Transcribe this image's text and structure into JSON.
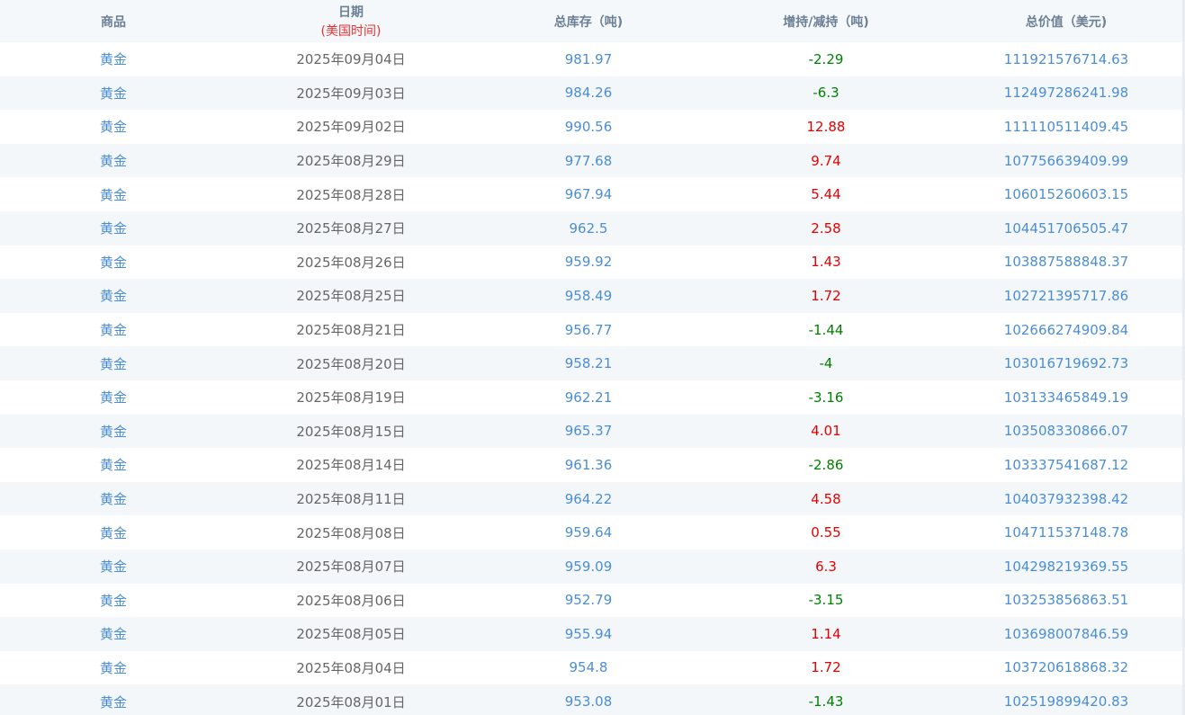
{
  "colors": {
    "header_bg": "#f4f8fb",
    "header_text": "#6b7f95",
    "subheader_text": "#e53333",
    "link_blue": "#4b8ed2",
    "date_text": "#666666",
    "increase": "#e60000",
    "decrease": "#008000",
    "stripe": "#f4f7fa"
  },
  "header": {
    "product": "商品",
    "date": "日期",
    "date_note": "(美国时间)",
    "total": "总库存（吨)",
    "change": "增持/减持（吨)",
    "value": "总价值（美元)"
  },
  "rows": [
    {
      "product": "黄金",
      "date": "2025年09月04日",
      "total": "981.97",
      "change": "-2.29",
      "direction": "down",
      "value": "111921576714.63"
    },
    {
      "product": "黄金",
      "date": "2025年09月03日",
      "total": "984.26",
      "change": "-6.3",
      "direction": "down",
      "value": "112497286241.98"
    },
    {
      "product": "黄金",
      "date": "2025年09月02日",
      "total": "990.56",
      "change": "12.88",
      "direction": "up",
      "value": "111110511409.45"
    },
    {
      "product": "黄金",
      "date": "2025年08月29日",
      "total": "977.68",
      "change": "9.74",
      "direction": "up",
      "value": "107756639409.99"
    },
    {
      "product": "黄金",
      "date": "2025年08月28日",
      "total": "967.94",
      "change": "5.44",
      "direction": "up",
      "value": "106015260603.15"
    },
    {
      "product": "黄金",
      "date": "2025年08月27日",
      "total": "962.5",
      "change": "2.58",
      "direction": "up",
      "value": "104451706505.47"
    },
    {
      "product": "黄金",
      "date": "2025年08月26日",
      "total": "959.92",
      "change": "1.43",
      "direction": "up",
      "value": "103887588848.37"
    },
    {
      "product": "黄金",
      "date": "2025年08月25日",
      "total": "958.49",
      "change": "1.72",
      "direction": "up",
      "value": "102721395717.86"
    },
    {
      "product": "黄金",
      "date": "2025年08月21日",
      "total": "956.77",
      "change": "-1.44",
      "direction": "down",
      "value": "102666274909.84"
    },
    {
      "product": "黄金",
      "date": "2025年08月20日",
      "total": "958.21",
      "change": "-4",
      "direction": "down",
      "value": "103016719692.73"
    },
    {
      "product": "黄金",
      "date": "2025年08月19日",
      "total": "962.21",
      "change": "-3.16",
      "direction": "down",
      "value": "103133465849.19"
    },
    {
      "product": "黄金",
      "date": "2025年08月15日",
      "total": "965.37",
      "change": "4.01",
      "direction": "up",
      "value": "103508330866.07"
    },
    {
      "product": "黄金",
      "date": "2025年08月14日",
      "total": "961.36",
      "change": "-2.86",
      "direction": "down",
      "value": "103337541687.12"
    },
    {
      "product": "黄金",
      "date": "2025年08月11日",
      "total": "964.22",
      "change": "4.58",
      "direction": "up",
      "value": "104037932398.42"
    },
    {
      "product": "黄金",
      "date": "2025年08月08日",
      "total": "959.64",
      "change": "0.55",
      "direction": "up",
      "value": "104711537148.78"
    },
    {
      "product": "黄金",
      "date": "2025年08月07日",
      "total": "959.09",
      "change": "6.3",
      "direction": "up",
      "value": "104298219369.55"
    },
    {
      "product": "黄金",
      "date": "2025年08月06日",
      "total": "952.79",
      "change": "-3.15",
      "direction": "down",
      "value": "103253856863.51"
    },
    {
      "product": "黄金",
      "date": "2025年08月05日",
      "total": "955.94",
      "change": "1.14",
      "direction": "up",
      "value": "103698007846.59"
    },
    {
      "product": "黄金",
      "date": "2025年08月04日",
      "total": "954.8",
      "change": "1.72",
      "direction": "up",
      "value": "103720618868.32"
    },
    {
      "product": "黄金",
      "date": "2025年08月01日",
      "total": "953.08",
      "change": "-1.43",
      "direction": "down",
      "value": "102519899420.83"
    }
  ]
}
